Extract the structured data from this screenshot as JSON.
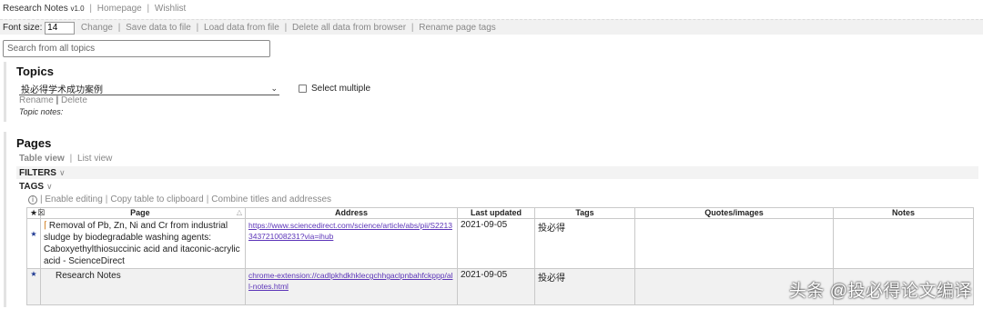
{
  "app": {
    "title": "Research Notes",
    "version": "v1.0",
    "links": [
      "Homepage",
      "Wishlist"
    ]
  },
  "toolbar": {
    "font_size_label": "Font size:",
    "font_size_value": "14",
    "actions": [
      "Change",
      "Save data to file",
      "Load data from file",
      "Delete all data from browser",
      "Rename page tags"
    ]
  },
  "search": {
    "placeholder": "Search from all topics"
  },
  "topics": {
    "heading": "Topics",
    "selected": "投必得学术成功案例",
    "select_multiple": "Select multiple",
    "rename": "Rename",
    "delete": "Delete",
    "notes_label": "Topic notes:"
  },
  "pages": {
    "heading": "Pages",
    "views": [
      "Table view",
      "List view"
    ],
    "filters": "FILTERS",
    "tags": "TAGS",
    "tools": [
      "Enable editing",
      "Copy table to clipboard",
      "Combine titles and addresses"
    ],
    "columns": [
      "★☒",
      "Page",
      "Address",
      "Last updated",
      "Tags",
      "Quotes/images",
      "Notes"
    ],
    "rows": [
      {
        "star": "★",
        "page": "Removal of Pb, Zn, Ni and Cr from industrial sludge by biodegradable washing agents: Caboxyethylthiosuccinic acid and itaconic-acrylic acid - ScienceDirect",
        "address": "https://www.sciencedirect.com/science/article/abs/pii/S2213343721008231?via=ihub",
        "updated": "2021-09-05",
        "tags": "投必得",
        "quotes": "",
        "notes": ""
      },
      {
        "star": "★",
        "page": "Research Notes",
        "address": "chrome-extension://cadlpkhdkhklecgchhgaclpnbahfckppp/all-notes.html",
        "updated": "2021-09-05",
        "tags": "投必得",
        "quotes": "",
        "notes": ""
      }
    ]
  },
  "watermark": "头条 @投必得论文编译"
}
